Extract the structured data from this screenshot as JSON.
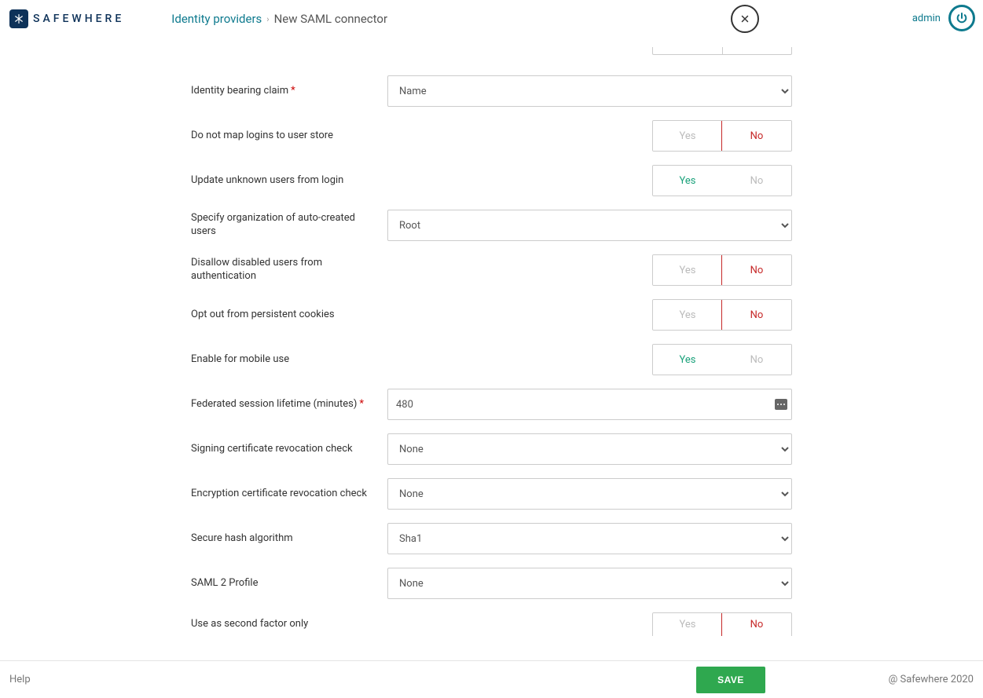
{
  "header": {
    "brand": "SAFEWHERE",
    "breadcrumb_link": "Identity providers",
    "breadcrumb_current": "New SAML connector",
    "user": "admin"
  },
  "toggle_labels": {
    "yes": "Yes",
    "no": "No"
  },
  "fields": {
    "identity_bearing_claim": {
      "label": "Identity bearing claim",
      "value": "Name"
    },
    "do_not_map_logins": {
      "label": "Do not map logins to user store"
    },
    "update_unknown_users": {
      "label": "Update unknown users from login"
    },
    "specify_org": {
      "label": "Specify organization of auto-created users",
      "value": "Root"
    },
    "disallow_disabled": {
      "label": "Disallow disabled users from authentication"
    },
    "opt_out_cookies": {
      "label": "Opt out from persistent cookies"
    },
    "enable_mobile": {
      "label": "Enable for mobile use"
    },
    "session_lifetime": {
      "label": "Federated session lifetime (minutes)",
      "value": "480"
    },
    "signing_cert_check": {
      "label": "Signing certificate revocation check",
      "value": "None"
    },
    "encryption_cert_check": {
      "label": "Encryption certificate revocation check",
      "value": "None"
    },
    "hash_algo": {
      "label": "Secure hash algorithm",
      "value": "Sha1"
    },
    "saml2_profile": {
      "label": "SAML 2 Profile",
      "value": "None"
    },
    "second_factor": {
      "label": "Use as second factor only"
    }
  },
  "footer": {
    "help": "Help",
    "save": "SAVE",
    "copyright": "@ Safewhere 2020"
  }
}
